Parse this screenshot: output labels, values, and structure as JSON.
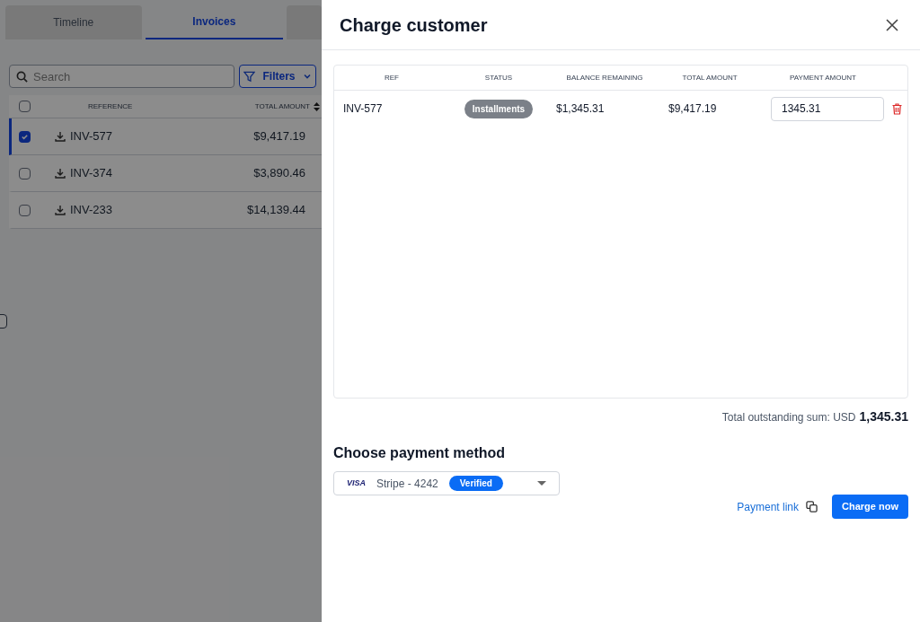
{
  "background": {
    "tabs": [
      {
        "label": "Timeline",
        "selected": false
      },
      {
        "label": "Invoices",
        "selected": true
      }
    ],
    "search": {
      "placeholder": "Search"
    },
    "filters_button": "Filters",
    "table": {
      "select_all_checked": false,
      "columns": [
        "REFERENCE",
        "TOTAL AMOUNT"
      ],
      "rows": [
        {
          "reference": "INV-577",
          "total": "$9,417.19",
          "checked": true
        },
        {
          "reference": "INV-374",
          "total": "$3,890.46",
          "checked": false
        },
        {
          "reference": "INV-233",
          "total": "$14,139.44",
          "checked": false
        }
      ]
    }
  },
  "dialog": {
    "title": "Charge customer",
    "table": {
      "columns": [
        "REF",
        "STATUS",
        "BALANCE REMAINING",
        "TOTAL AMOUNT",
        "PAYMENT AMOUNT"
      ],
      "rows": [
        {
          "ref": "INV-577",
          "status": "Installments",
          "balance": "$1,345.31",
          "total": "$9,417.19",
          "payment_amount": "1345.31"
        }
      ]
    },
    "total_label": "Total outstanding sum: USD",
    "total_value": "1,345.31",
    "payment_method_heading": "Choose payment method",
    "payment_method": {
      "card_brand": "VISA",
      "label": "Stripe - 4242",
      "badge": "Verified"
    },
    "payment_link": "Payment link",
    "charge_button": "Charge now"
  }
}
